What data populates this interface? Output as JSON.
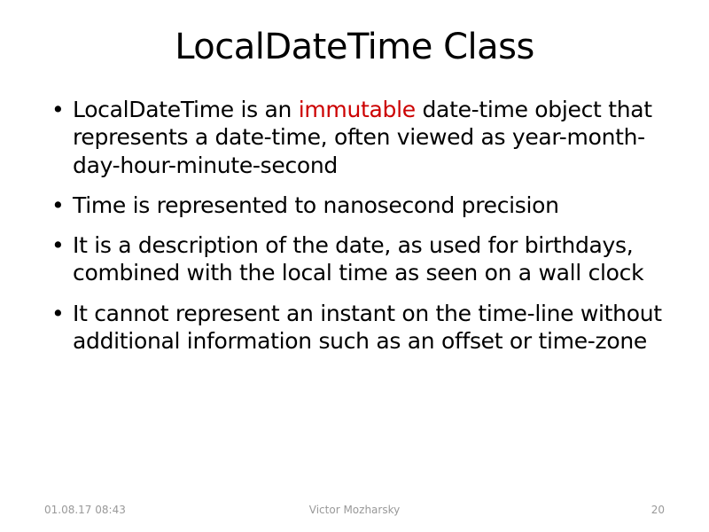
{
  "title": "LocalDateTime Class",
  "bullets": [
    {
      "prefix": "LocalDateTime is an ",
      "highlight": "immutable",
      "suffix": " date-time object that represents a date-time, often viewed as year-month-day-hour-minute-second"
    },
    {
      "prefix": "Time is represented to nanosecond precision",
      "highlight": "",
      "suffix": ""
    },
    {
      "prefix": "It is a description of the date, as used for birthdays, combined with the local time as seen on a wall clock",
      "highlight": "",
      "suffix": ""
    },
    {
      "prefix": "It cannot represent an instant on the time-line without additional information such as an offset or time-zone",
      "highlight": "",
      "suffix": ""
    }
  ],
  "footer": {
    "date": "01.08.17 08:43",
    "author": "Victor Mozharsky",
    "page": "20"
  }
}
